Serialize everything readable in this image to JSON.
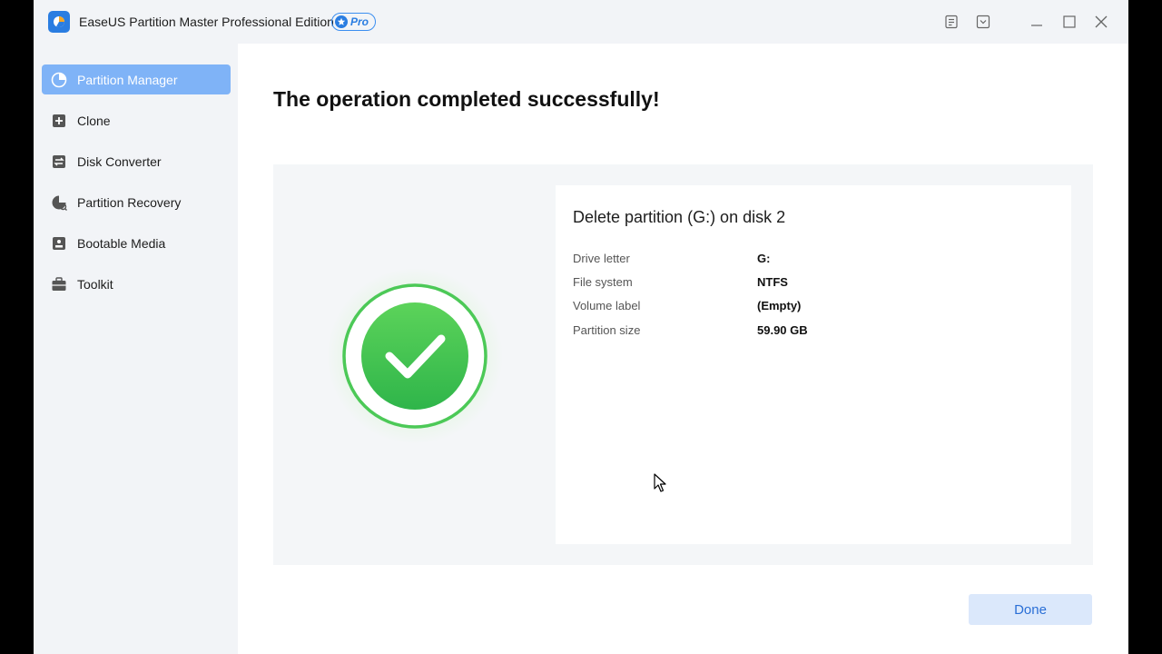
{
  "titlebar": {
    "app_title": "EaseUS Partition Master Professional Edition",
    "badge": "Pro",
    "icons": [
      "feedback-icon",
      "menu-dropdown-icon",
      "minimize-icon",
      "maximize-icon",
      "close-icon"
    ]
  },
  "sidebar": {
    "items": [
      {
        "label": "Partition Manager",
        "icon": "pie-chart-icon",
        "active": true
      },
      {
        "label": "Clone",
        "icon": "clone-icon",
        "active": false
      },
      {
        "label": "Disk Converter",
        "icon": "disk-converter-icon",
        "active": false
      },
      {
        "label": "Partition Recovery",
        "icon": "partition-recovery-icon",
        "active": false
      },
      {
        "label": "Bootable Media",
        "icon": "bootable-media-icon",
        "active": false
      },
      {
        "label": "Toolkit",
        "icon": "toolkit-icon",
        "active": false
      }
    ]
  },
  "main": {
    "title": "The operation completed successfully!",
    "operation_title": "Delete partition (G:) on disk 2",
    "details": [
      {
        "key": "Drive letter",
        "value": "G:"
      },
      {
        "key": "File system",
        "value": "NTFS"
      },
      {
        "key": "Volume label",
        "value": "(Empty)"
      },
      {
        "key": "Partition size",
        "value": "59.90 GB"
      }
    ],
    "done_label": "Done"
  },
  "colors": {
    "accent": "#2a7de1",
    "active_nav": "#7fb3f7",
    "success_green": "#3cc24a"
  }
}
